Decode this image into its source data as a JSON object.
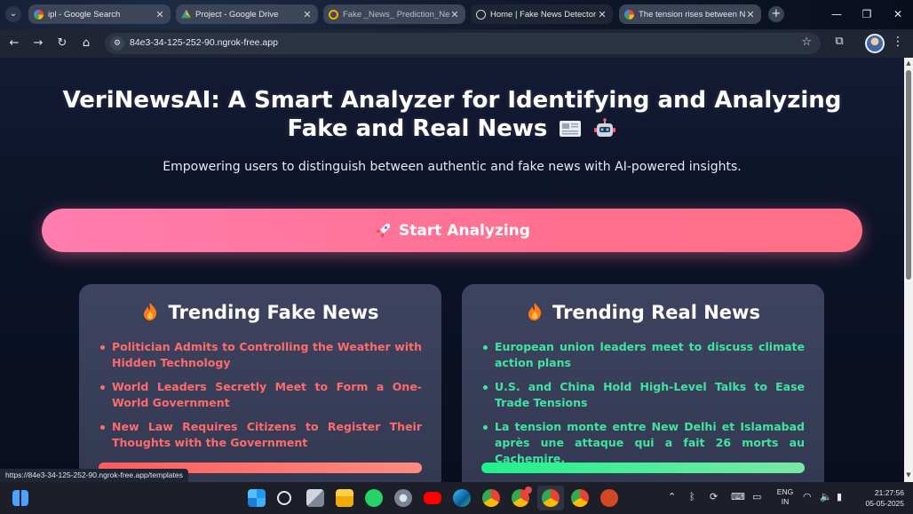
{
  "browser": {
    "tabs": [
      {
        "title": "ipl - Google Search",
        "active": false,
        "favicon": "google-icon"
      },
      {
        "title": "Project - Google Drive",
        "active": false,
        "favicon": "drive-icon"
      },
      {
        "title": "Fake _News_ Prediction_New",
        "active": false,
        "favicon": "colab-icon"
      },
      {
        "title": "Home | Fake News Detector",
        "active": true,
        "favicon": "globe-icon"
      },
      {
        "title": "The tension rises between N",
        "active": false,
        "favicon": "google-icon"
      }
    ],
    "url": "84e3-34-125-252-90.ngrok-free.app",
    "status_url": "https://84e3-34-125-252-90.ngrok-free.app/templates"
  },
  "hero": {
    "title_line1": "VeriNewsAI: A Smart Analyzer for Identifying and Analyzing",
    "title_line2": "Fake and Real News",
    "subtitle": "Empowering users to distinguish between authentic and fake news with AI-powered insights.",
    "cta_label": "Start Analyzing"
  },
  "fake_card": {
    "title": "Trending Fake News",
    "items": [
      "Politician Admits to Controlling the Weather with Hidden Technology",
      "World Leaders Secretly Meet to Form a One-World Government",
      "New Law Requires Citizens to Register Their Thoughts with the Government"
    ]
  },
  "real_card": {
    "title": "Trending Real News",
    "items": [
      "European union leaders meet to discuss climate action plans",
      "U.S. and China Hold High-Level Talks to Ease Trade Tensions",
      "La tension monte entre New Delhi et Islamabad après une attaque qui a fait 26 morts au Cachemire."
    ]
  },
  "taskbar": {
    "lang_line1": "ENG",
    "lang_line2": "IN",
    "time": "21:27:56",
    "date": "05-05-2025"
  },
  "colors": {
    "fake_text": "#ff6b6b",
    "real_text": "#3ee5a0",
    "cta": "#ff7aa2",
    "page_bg": "#0c1226"
  }
}
